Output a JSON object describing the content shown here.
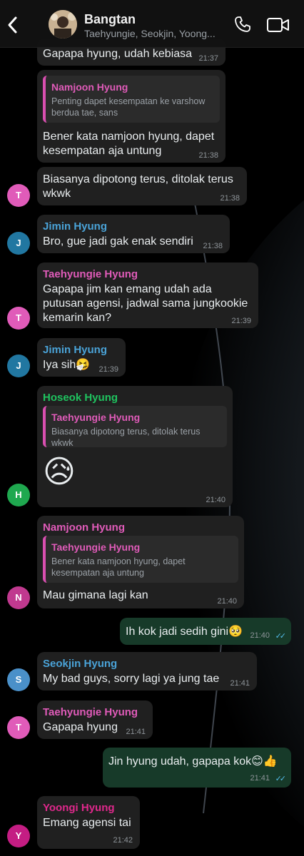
{
  "header": {
    "title": "Bangtan",
    "subtitle": "Taehyungie, Seokjin, Yoong..."
  },
  "colors": {
    "pink": "#e05bb9",
    "blue": "#4aa3d8",
    "green": "#1fc35f",
    "outgoing": "#173a29",
    "incoming": "#202020"
  },
  "messages": [
    {
      "text": "Gapapa hyung, udah kebiasa",
      "time": "21:37"
    },
    {
      "quote_sender": "Namjoon Hyung",
      "quote_text": "Penting dapet kesempatan ke varshow berdua tae, sans",
      "text": "Bener kata namjoon hyung, dapet kesempatan aja untung",
      "time": "21:38"
    },
    {
      "text": "Biasanya dipotong terus, ditolak terus wkwk",
      "time": "21:38",
      "avatar": "T"
    },
    {
      "sender": "Jimin Hyung",
      "text": "Bro, gue jadi gak enak sendiri",
      "time": "21:38",
      "avatar": "J"
    },
    {
      "sender": "Taehyungie Hyung",
      "text": "Gapapa jim kan emang udah ada putusan agensi, jadwal sama jungkookie kemarin kan?",
      "time": "21:39",
      "avatar": "T"
    },
    {
      "sender": "Jimin Hyung",
      "text": "Iya sih🤧",
      "time": "21:39",
      "avatar": "J"
    },
    {
      "sender": "Hoseok Hyung",
      "quote_sender": "Taehyungie Hyung",
      "quote_text": "Biasanya dipotong terus, ditolak terus wkwk",
      "text": "😥",
      "time": "21:40",
      "avatar": "H"
    },
    {
      "sender": "Namjoon Hyung",
      "quote_sender": "Taehyungie Hyung",
      "quote_text": "Bener kata namjoon hyung, dapet kesempatan aja untung",
      "text": "Mau gimana lagi kan",
      "time": "21:40",
      "avatar": "N"
    },
    {
      "text": "Ih kok jadi sedih gini🥺",
      "time": "21:40",
      "outgoing": true
    },
    {
      "sender": "Seokjin Hyung",
      "text": "My bad guys, sorry lagi ya jung tae",
      "time": "21:41",
      "avatar": "S"
    },
    {
      "sender": "Taehyungie Hyung",
      "text": "Gapapa hyung",
      "time": "21:41",
      "avatar": "T"
    },
    {
      "text": "Jin hyung udah, gapapa kok😊👍",
      "time": "21:41",
      "outgoing": true
    },
    {
      "sender": "Yoongi Hyung",
      "text": "Emang agensi tai",
      "time": "21:42",
      "avatar": "Y"
    }
  ]
}
